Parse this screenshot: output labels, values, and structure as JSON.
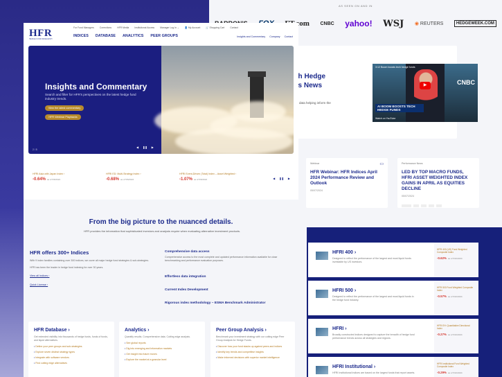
{
  "back": {
    "seen_label": "AS SEEN ON AND IN",
    "logos": [
      {
        "key": "barrons",
        "label": "BARRON'S",
        "cls": "logo"
      },
      {
        "key": "fox",
        "label": "FOX",
        "cls": "logo fox"
      },
      {
        "key": "ft",
        "label": "FT.com",
        "cls": "logo ft"
      },
      {
        "key": "cnbc",
        "label": "CNBC",
        "cls": "logo cnbc"
      },
      {
        "key": "yahoo",
        "label": "yahoo!",
        "cls": "logo yahoo"
      },
      {
        "key": "wsj",
        "label": "WSJ",
        "cls": "logo wsj"
      },
      {
        "key": "reuters",
        "label": "REUTERS",
        "cls": "logo reuters"
      },
      {
        "key": "hedgeweek",
        "label": "HEDGEWEEK.COM",
        "cls": "logo hedge"
      }
    ],
    "news_title": "ch Hedge\nss News",
    "news_sub": "data helping inform the",
    "video": {
      "top": "3:12 Boom boosts tech hedge funds",
      "caption": "AI BOOM BOOSTS TECH HEDGE FUNDS",
      "network": "CNBC",
      "watch": "Watch on YouTube"
    },
    "blog_cards": [
      {
        "tag": "Webinar",
        "title": "HFR Webinar: HFR Indices April 2024 Performance Review and Outlook",
        "date": "05/07/2024"
      },
      {
        "tag": "Performance News",
        "title": "LED BY TOP MACRO FUNDS, HFRI ASSET WEIGHTED INDEX GAINS IN APRIL AS EQUITIES DECLINE",
        "date": "05/07/2024"
      }
    ],
    "index_cards": [
      {
        "name": "HFRI 400 ›",
        "desc": "Designed to reflect the performance of the largest and most liquid funds investable by US investors.",
        "side_title": "HFRI 400 (US) Fund Weighted Composite Index",
        "value": "-0.62%",
        "date": "as of 5/10/2024"
      },
      {
        "name": "HFRI 500 ›",
        "desc": "Designed to reflect the performance of the largest and most liquid funds in the hedge fund industry.",
        "side_title": "HFRI 500 Fund Weighted Composite Index",
        "value": "-0.57%",
        "date": "as of 5/10/2024"
      },
      {
        "name": "HFRI ›",
        "desc": "Broadly constructed indices designed to capture the breadth of hedge fund performance trends across all strategies and regions.",
        "side_title": "HFRI EH: Quantitative Directional Index",
        "value": "-0.27%",
        "date": "as of 5/10/2024"
      },
      {
        "name": "HFRI Institutional ›",
        "desc": "HFRI Institutional Indices are based on the largest funds that report assets.",
        "side_title": "HFRI Institutional Fund Weighted Composite Index",
        "value": "-0.29%",
        "date": "as of 5/10/2024"
      }
    ]
  },
  "front": {
    "logo": "HFR",
    "logo_sub": "HEDGE FUND RESEARCH",
    "topbar": [
      "For Fund Managers",
      "Corrections",
      "HFR Media",
      "Institutional Access",
      "Manager Log In ⌄",
      "👤 My Account",
      "🛒 Shopping Cart",
      "Contact"
    ],
    "mainnav": [
      "INDICES",
      "DATABASE",
      "ANALYTICS",
      "PEER GROUPS"
    ],
    "rightnav": [
      "Insights and Commentary",
      "Company",
      "Contact"
    ],
    "hero": {
      "title": "Insights and Commentary",
      "subtitle": "Search and filter for HFR's perspectives on the latest hedge fund industry trends.",
      "btn1": "View the latest commentary",
      "btn2": "HFR Webinar Playbacks",
      "page": "2 / 5",
      "controls": [
        "◀",
        "❚❚",
        "▶"
      ]
    },
    "tickers": [
      {
        "name": "HFRI Asia with Japan Index ›",
        "value": "-0.64%",
        "date": "as of 5/6/2024"
      },
      {
        "name": "HFRI ED: Multi-Strategy Index ›",
        "value": "-0.68%",
        "date": "as of 5/6/2024"
      },
      {
        "name": "HFRI Event-Driven (Total) Index – Asset Weighted ›",
        "value": "-1.07%",
        "date": "as of 5/6/2024"
      }
    ],
    "ticker_controls": [
      "◀",
      "❚❚",
      "▶"
    ],
    "section_title": "From the big picture to the nuanced details.",
    "section_sub": "HFR provides the information that sophisticated investors and analysts require when evaluating alternative investment products.",
    "offers_title": "HFR offers 300+ Indices",
    "offers_p1": "With 9 index families containing over 300 indices, we cover all major hedge fund strategies & sub-strategies.",
    "offers_p2": "HFR has been the leader in hedge fund indexing for over 30 years.",
    "link1": "View all Indices ›",
    "link2": "Quick License ›",
    "features": [
      {
        "title": "Comprehensive data access",
        "desc": "Comprehensive access to the most complete and updated performance information available for close benchmarking and performance evaluation purposes."
      },
      {
        "title": "Effortless data integration",
        "desc": ""
      },
      {
        "title": "Current Index Development",
        "desc": ""
      },
      {
        "title": "Rigorous index methodology – ESMA Benchmark Administrator",
        "desc": ""
      }
    ],
    "products": [
      {
        "title": "HFR Database ›",
        "desc": "Get extended visibility into thousands of hedge funds, funds of funds, and liquid alternatives.",
        "bullets": [
          "Define your peer groups and sub-strategies",
          "Explore seven distinct strategy types",
          "Integrate with software vendors",
          "Find cutting edge alternatives"
        ]
      },
      {
        "title": "Analytics ›",
        "desc": "Quantify results. Comprehensive data. Cutting edge analysis.",
        "bullets": [
          "See global reports",
          "Dig into emerging and information markets",
          "Get insight into future moves",
          "Explore the market at a granular level"
        ]
      },
      {
        "title": "Peer Group Analysis ›",
        "desc": "Benchmark your investment strategy with our cutting edge Peer Group Analysis for Hedge Funds.",
        "bullets": [
          "Discover how your fund stacks up against peers and indices",
          "Identify key trends and competitive insights",
          "Make informed decisions with superior market intelligence"
        ]
      }
    ]
  }
}
